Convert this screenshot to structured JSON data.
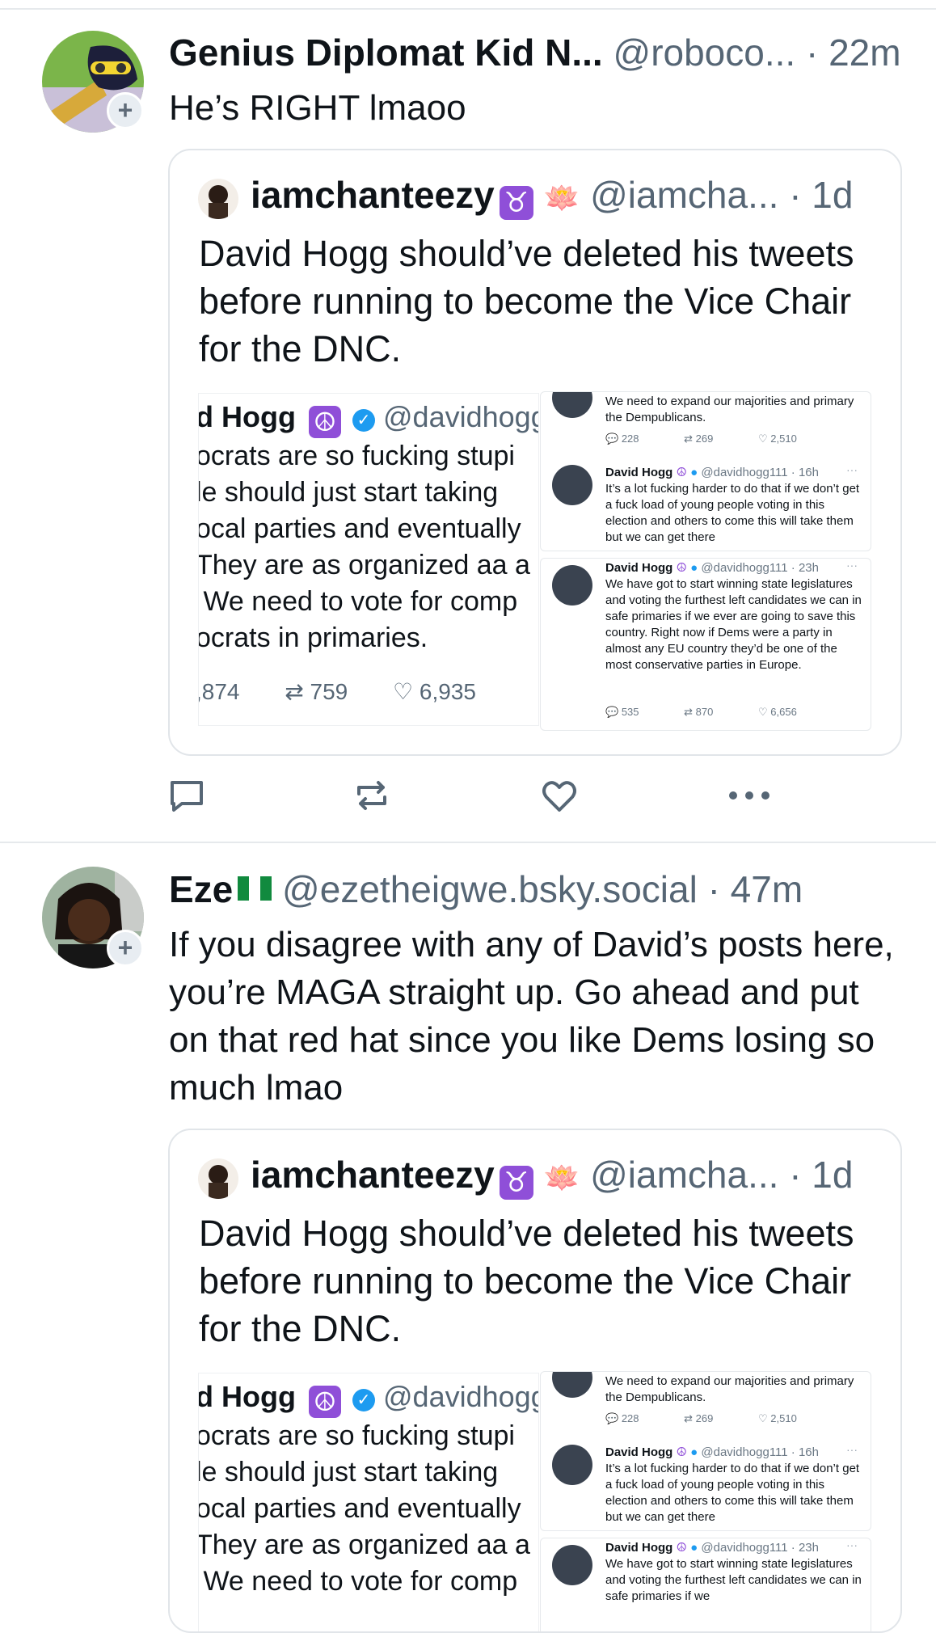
{
  "posts": [
    {
      "display_name": "Genius Diplomat Kid N...",
      "handle": "@roboco...",
      "time": "· 22m",
      "text": "He’s RIGHT lmaoo",
      "quote": {
        "display_name": "iamchanteezy",
        "emoji": "♉",
        "emoji2": "🪷",
        "handle": "@iamcha...",
        "time": "· 1d",
        "text": "David Hogg should’ve deleted his tweets before running to become the Vice Chair for the DNC.",
        "left_shot": {
          "name": "d Hogg",
          "peace": "☮",
          "handle": "@davidhogg",
          "lines": [
            "ocrats are so fucking stupi",
            "le should just start taking",
            "ocal parties and eventually",
            "They are as organized aa a",
            " We need to vote for comp",
            "ocrats in primaries."
          ],
          "stats": {
            "replies": ",874",
            "reposts": "759",
            "likes": "6,935"
          }
        },
        "right_shot": {
          "top_text": "We need to expand our majorities and primary the Dempublicans.",
          "top_stats": {
            "replies": "228",
            "reposts": "269",
            "likes": "2,510"
          },
          "tweet1": {
            "name": "David Hogg",
            "handle": "@davidhogg111 · 16h",
            "text": "It’s a lot fucking harder to do that if we don’t get a fuck load of young people voting in this election and others to come this will take them but we can get there"
          },
          "tweet2": {
            "name": "David Hogg",
            "handle": "@davidhogg111 · 23h",
            "text": "We have got to start winning state legislatures and voting the furthest left candidates we can in safe primaries if we ever are going to save this country. Right now if Dems were a party in almost any EU country they’d be one of the most conservative parties in Europe.",
            "stats": {
              "replies": "535",
              "reposts": "870",
              "likes": "6,656"
            }
          }
        }
      }
    },
    {
      "display_name": "Eze",
      "handle": "@ezetheigwe.bsky.social",
      "time": "· 47m",
      "text": "If you disagree with any of David’s posts here, you’re MAGA straight up. Go ahead and put on that red hat since you like Dems losing so much lmao",
      "quote": {
        "display_name": "iamchanteezy",
        "emoji": "♉",
        "emoji2": "🪷",
        "handle": "@iamcha...",
        "time": "· 1d",
        "text": "David Hogg should’ve deleted his tweets before running to become the Vice Chair for the DNC.",
        "left_shot": {
          "name": "d Hogg",
          "peace": "☮",
          "handle": "@davidhogg",
          "lines": [
            "ocrats are so fucking stupi",
            "le should just start taking",
            "ocal parties and eventually",
            "They are as organized aa a",
            " We need to vote for comp"
          ]
        },
        "right_shot": {
          "top_text": "We need to expand our majorities and primary the Dempublicans.",
          "top_stats": {
            "replies": "228",
            "reposts": "269",
            "likes": "2,510"
          },
          "tweet1": {
            "name": "David Hogg",
            "handle": "@davidhogg111 · 16h",
            "text": "It’s a lot fucking harder to do that if we don’t get a fuck load of young people voting in this election and others to come this will take them but we can get there"
          },
          "tweet2": {
            "name": "David Hogg",
            "handle": "@davidhogg111 · 23h",
            "text": "We have got to start winning state legislatures and voting the furthest left candidates we can in safe primaries if we"
          }
        }
      }
    }
  ],
  "actions": {
    "reply_icon": "reply-icon",
    "repost_icon": "repost-icon",
    "like_icon": "like-icon",
    "more_icon": "more-icon"
  },
  "colors": {
    "text": "#0f1419",
    "muted": "#566675",
    "border": "#e1e5e9",
    "icon": "#566675",
    "accent": "#1d9bf0"
  }
}
